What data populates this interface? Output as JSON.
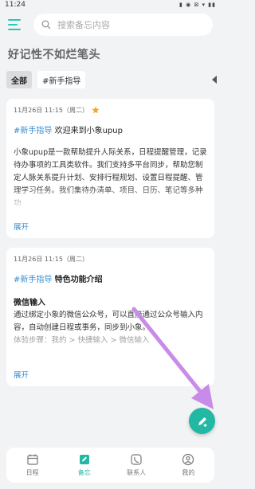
{
  "status": {
    "time": "11:24",
    "indicators": "▮ ◉ ⊠ ▾ ▮▮"
  },
  "search": {
    "placeholder": "搜索备忘内容"
  },
  "page_title": "好记性不如烂笔头",
  "tags": [
    {
      "label": "全部",
      "active": true
    },
    {
      "label": "#新手指导",
      "active": false
    }
  ],
  "cards": [
    {
      "date": "11月26日 11:15（周二）",
      "hashtag": "#新手指导",
      "title": "欢迎来到小象upup",
      "body": "小象upup是一款帮助提升人际关系，日程提醒管理，记录待办事项的工具类软件。我们支持多平台同步，帮助您制定人脉关系提升计划、安排行程规划、设置日程提醒、管理学习任务。我们集待办清单、项目、日历、笔记等多种功",
      "expand": "展开"
    },
    {
      "date": "11月26日 11:15（周二）",
      "hashtag": "#新手指导",
      "title": "特色功能介绍",
      "subtitle": "微信输入",
      "body": "通过绑定小象的微信公众号，可以直接通过公众号输入内容，自动创建日程或事务，同步到小象。",
      "body_muted": "体验步骤：我的 > 快捷输入 > 微信输入",
      "expand": "展开"
    }
  ],
  "tabbar": [
    {
      "label": "日程",
      "icon": "calendar-icon",
      "active": false
    },
    {
      "label": "备忘",
      "icon": "memo-icon",
      "active": true
    },
    {
      "label": "联系人",
      "icon": "contacts-icon",
      "active": false
    },
    {
      "label": "我的",
      "icon": "profile-icon",
      "active": false
    }
  ],
  "colors": {
    "accent": "#22b8a3",
    "link": "#3a8ccf",
    "star": "#f5a623",
    "annotation": "#c98be8"
  }
}
